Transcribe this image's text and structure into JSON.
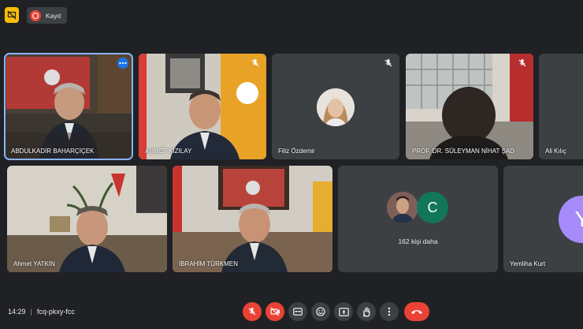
{
  "topbar": {
    "record_label": "Kayıt"
  },
  "participants": [
    {
      "name": "ABDULKADİR BAHARÇİÇEK"
    },
    {
      "name": "AHMET KIZILAY"
    },
    {
      "name": "Filiz Özdemir"
    },
    {
      "name": "PROF. DR. SÜLEYMAN NİHAT ŞAD"
    },
    {
      "name": "Ali Kılıç"
    },
    {
      "name": "Ahmet YATKIN"
    },
    {
      "name": "İBRAHİM TÜRKMEN"
    },
    {
      "name": "Yemliha Kurt"
    }
  ],
  "others": {
    "label": "162 kişi daha",
    "avatar_letter": "C"
  },
  "yemliha_avatar_letter": "Y",
  "meeting": {
    "time": "14:29",
    "separator": "|",
    "code": "fcq-pkxy-fcc"
  },
  "colors": {
    "accent": "#8ab4f8",
    "danger": "#ea4335",
    "surface": "#3c4043",
    "background": "#202124"
  }
}
